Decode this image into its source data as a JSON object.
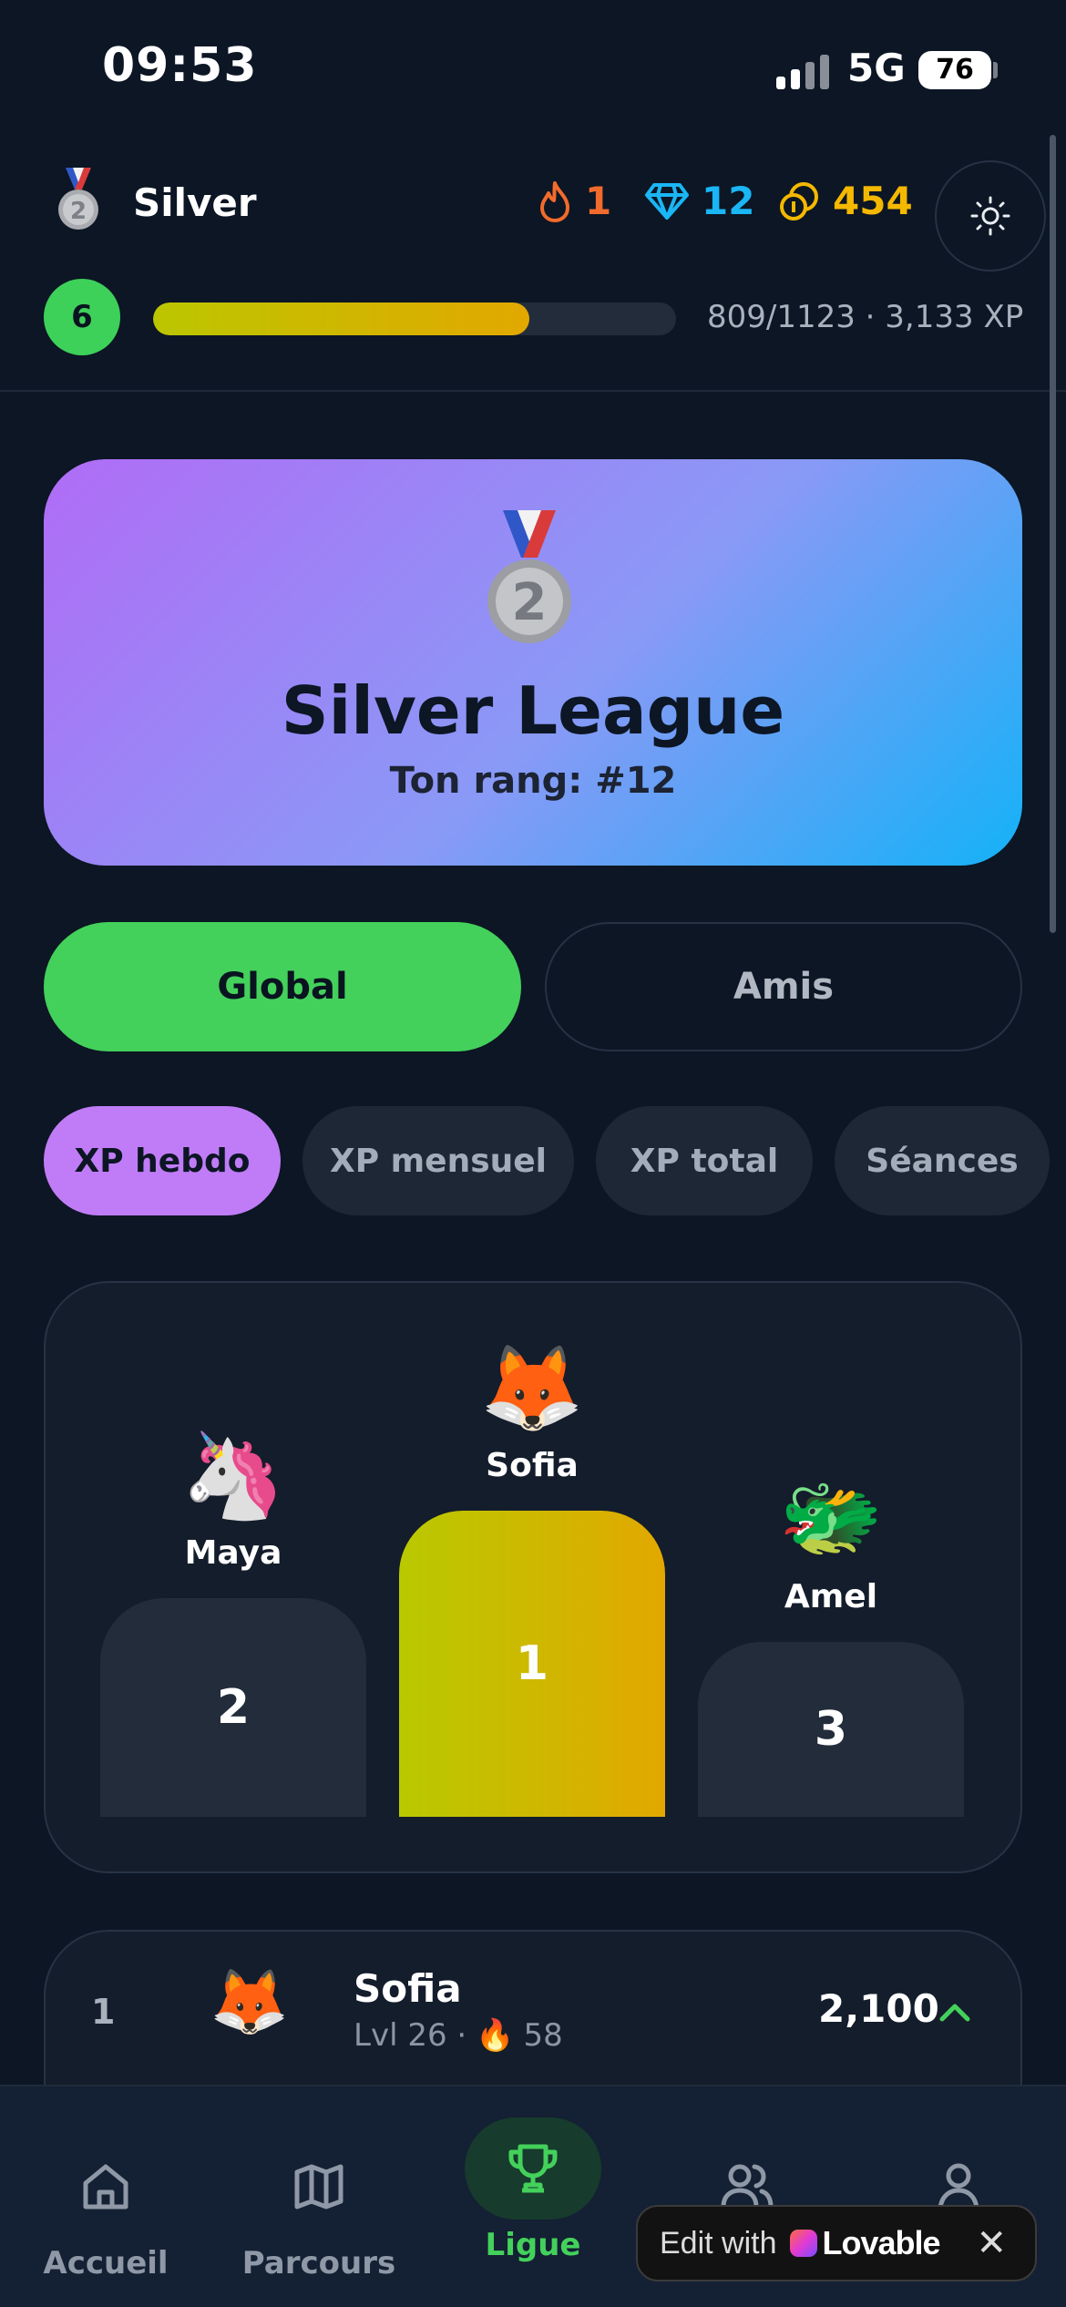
{
  "status_bar": {
    "time": "09:53",
    "network": "5G",
    "battery": "76"
  },
  "header": {
    "league_name": "Silver",
    "streak": "1",
    "gems": "12",
    "coins": "454"
  },
  "level": {
    "number": "6",
    "xp_progress": 0.72,
    "xp_text": "809/1123 · 3,133 XP"
  },
  "league_card": {
    "title": "Silver League",
    "rank": "Ton rang: #12",
    "medal_number": "2"
  },
  "scope_tabs": [
    {
      "label": "Global",
      "active": true
    },
    {
      "label": "Amis",
      "active": false
    }
  ],
  "metric_chips": [
    {
      "label": "XP hebdo",
      "active": true
    },
    {
      "label": "XP mensuel",
      "active": false
    },
    {
      "label": "XP total",
      "active": false
    },
    {
      "label": "Séances",
      "active": false
    }
  ],
  "podium": [
    {
      "place": "2",
      "name": "Maya",
      "avatar": "🦄"
    },
    {
      "place": "1",
      "name": "Sofia",
      "avatar": "🦊"
    },
    {
      "place": "3",
      "name": "Amel",
      "avatar": "🐲"
    }
  ],
  "leaderboard": [
    {
      "rank": "1",
      "avatar": "🦊",
      "name": "Sofia",
      "level": "Lvl 26 ·",
      "streak_icon": "🔥",
      "streak": "58",
      "score": "2,100",
      "trend": "up"
    }
  ],
  "bottom_nav": [
    {
      "label": "Accueil",
      "icon": "home-icon",
      "active": false
    },
    {
      "label": "Parcours",
      "icon": "map-icon",
      "active": false
    },
    {
      "label": "Ligue",
      "icon": "trophy-icon",
      "active": true
    },
    {
      "label": "Amis",
      "icon": "users-icon",
      "active": false
    },
    {
      "label": "Profil",
      "icon": "user-icon",
      "active": false
    }
  ],
  "lovable_badge": {
    "text": "Edit with",
    "brand": "Lovable",
    "close": "✕"
  },
  "colors": {
    "background": "#0c1624",
    "accent_green": "#43d15b",
    "accent_purple": "#c07cf7",
    "gold": "#f5b800",
    "streak_orange": "#f26b2c",
    "gem_blue": "#1ab6f5"
  }
}
